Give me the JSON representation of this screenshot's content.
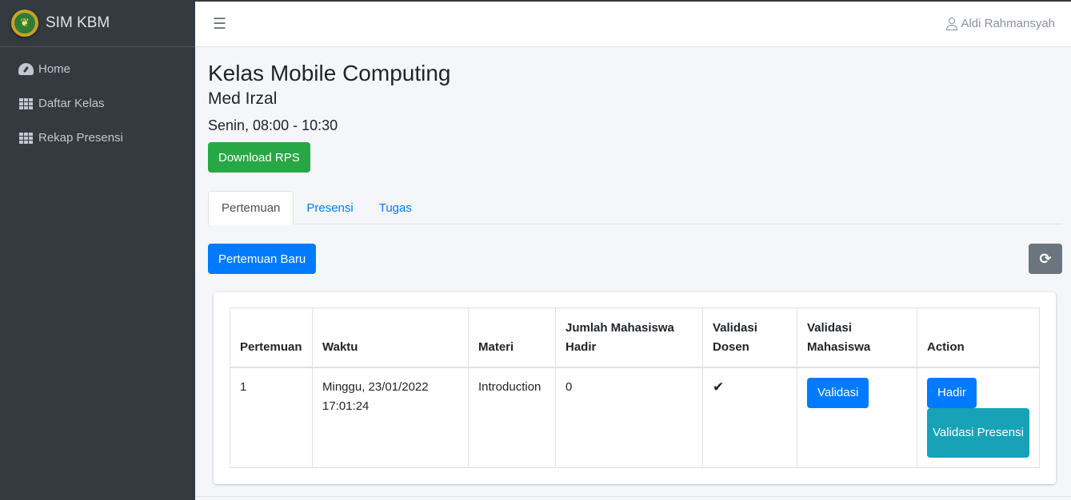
{
  "app": {
    "brand": "SIM KBM",
    "brand_logo": "university-seal"
  },
  "sidebar": {
    "items": [
      {
        "label": "Home",
        "icon": "dashboard-gauge-icon"
      },
      {
        "label": "Daftar Kelas",
        "icon": "grid-icon"
      },
      {
        "label": "Rekap Presensi",
        "icon": "grid-icon"
      }
    ]
  },
  "topbar": {
    "menu_icon": "hamburger-icon",
    "user_name": "Aldi Rahmansyah",
    "user_icon": "user-icon"
  },
  "course": {
    "title": "Kelas Mobile Computing",
    "lecturer": "Med Irzal",
    "schedule": "Senin, 08:00 - 10:30",
    "download_label": "Download RPS"
  },
  "tabs": [
    {
      "label": "Pertemuan",
      "active": true
    },
    {
      "label": "Presensi",
      "active": false
    },
    {
      "label": "Tugas",
      "active": false
    }
  ],
  "toolbar": {
    "new_meeting_label": "Pertemuan Baru",
    "refresh_icon": "refresh-icon"
  },
  "table": {
    "headers": [
      "Pertemuan",
      "Waktu",
      "Materi",
      "Jumlah Mahasiswa Hadir",
      "Validasi Dosen",
      "Validasi Mahasiswa",
      "Action"
    ],
    "rows": [
      {
        "pertemuan": "1",
        "waktu": "Minggu, 23/01/2022 17:01:24",
        "materi": "Introduction",
        "jumlah_hadir": "0",
        "validasi_dosen": "✔",
        "validasi_mahasiswa_button": "Validasi",
        "action_hadir": "Hadir",
        "action_validasi_presensi": "Validasi Presensi"
      }
    ]
  },
  "colors": {
    "sidebar": "#343a40",
    "primary": "#007bff",
    "success": "#28a745",
    "info": "#17a2b8",
    "secondary": "#6c757d"
  }
}
